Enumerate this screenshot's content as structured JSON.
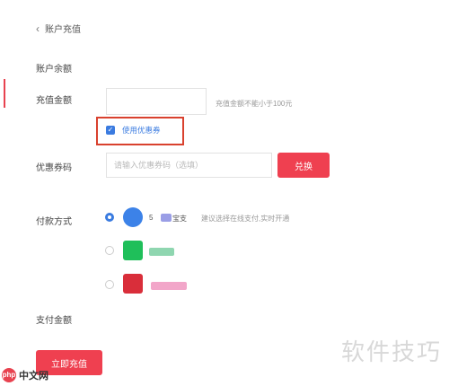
{
  "header": {
    "back_title": "账户充值"
  },
  "labels": {
    "balance": "账户余额",
    "recharge_amount": "充值金额",
    "coupon_code": "优惠券码",
    "payment_method": "付款方式",
    "pay_amount": "支付金额"
  },
  "amount": {
    "value": "",
    "hint": "充值金额不能小于100元"
  },
  "coupon": {
    "checkbox_label": "使用优惠券",
    "checked": true,
    "code_placeholder": "请输入优惠券码（选填）",
    "redeem_label": "兑换"
  },
  "payment": {
    "options": [
      {
        "prefix": "5",
        "name_suffix": "宝支",
        "selected": true,
        "logo_color": "#3c82e8"
      },
      {
        "prefix": "",
        "name_suffix": "",
        "selected": false,
        "logo_color": "#1fbf5a"
      },
      {
        "prefix": "",
        "name_suffix": "",
        "selected": false,
        "logo_color": "#d92e3a"
      }
    ],
    "tip": "建议选择在线支付,实时开通"
  },
  "pay_amount_value": "",
  "submit_label": "立即充值",
  "watermark": "软件技巧",
  "brand": {
    "badge": "php",
    "text": "中文网"
  },
  "colors": {
    "accent_red": "#ef4050",
    "link_blue": "#3a7be0",
    "highlight": "#d9412e"
  }
}
